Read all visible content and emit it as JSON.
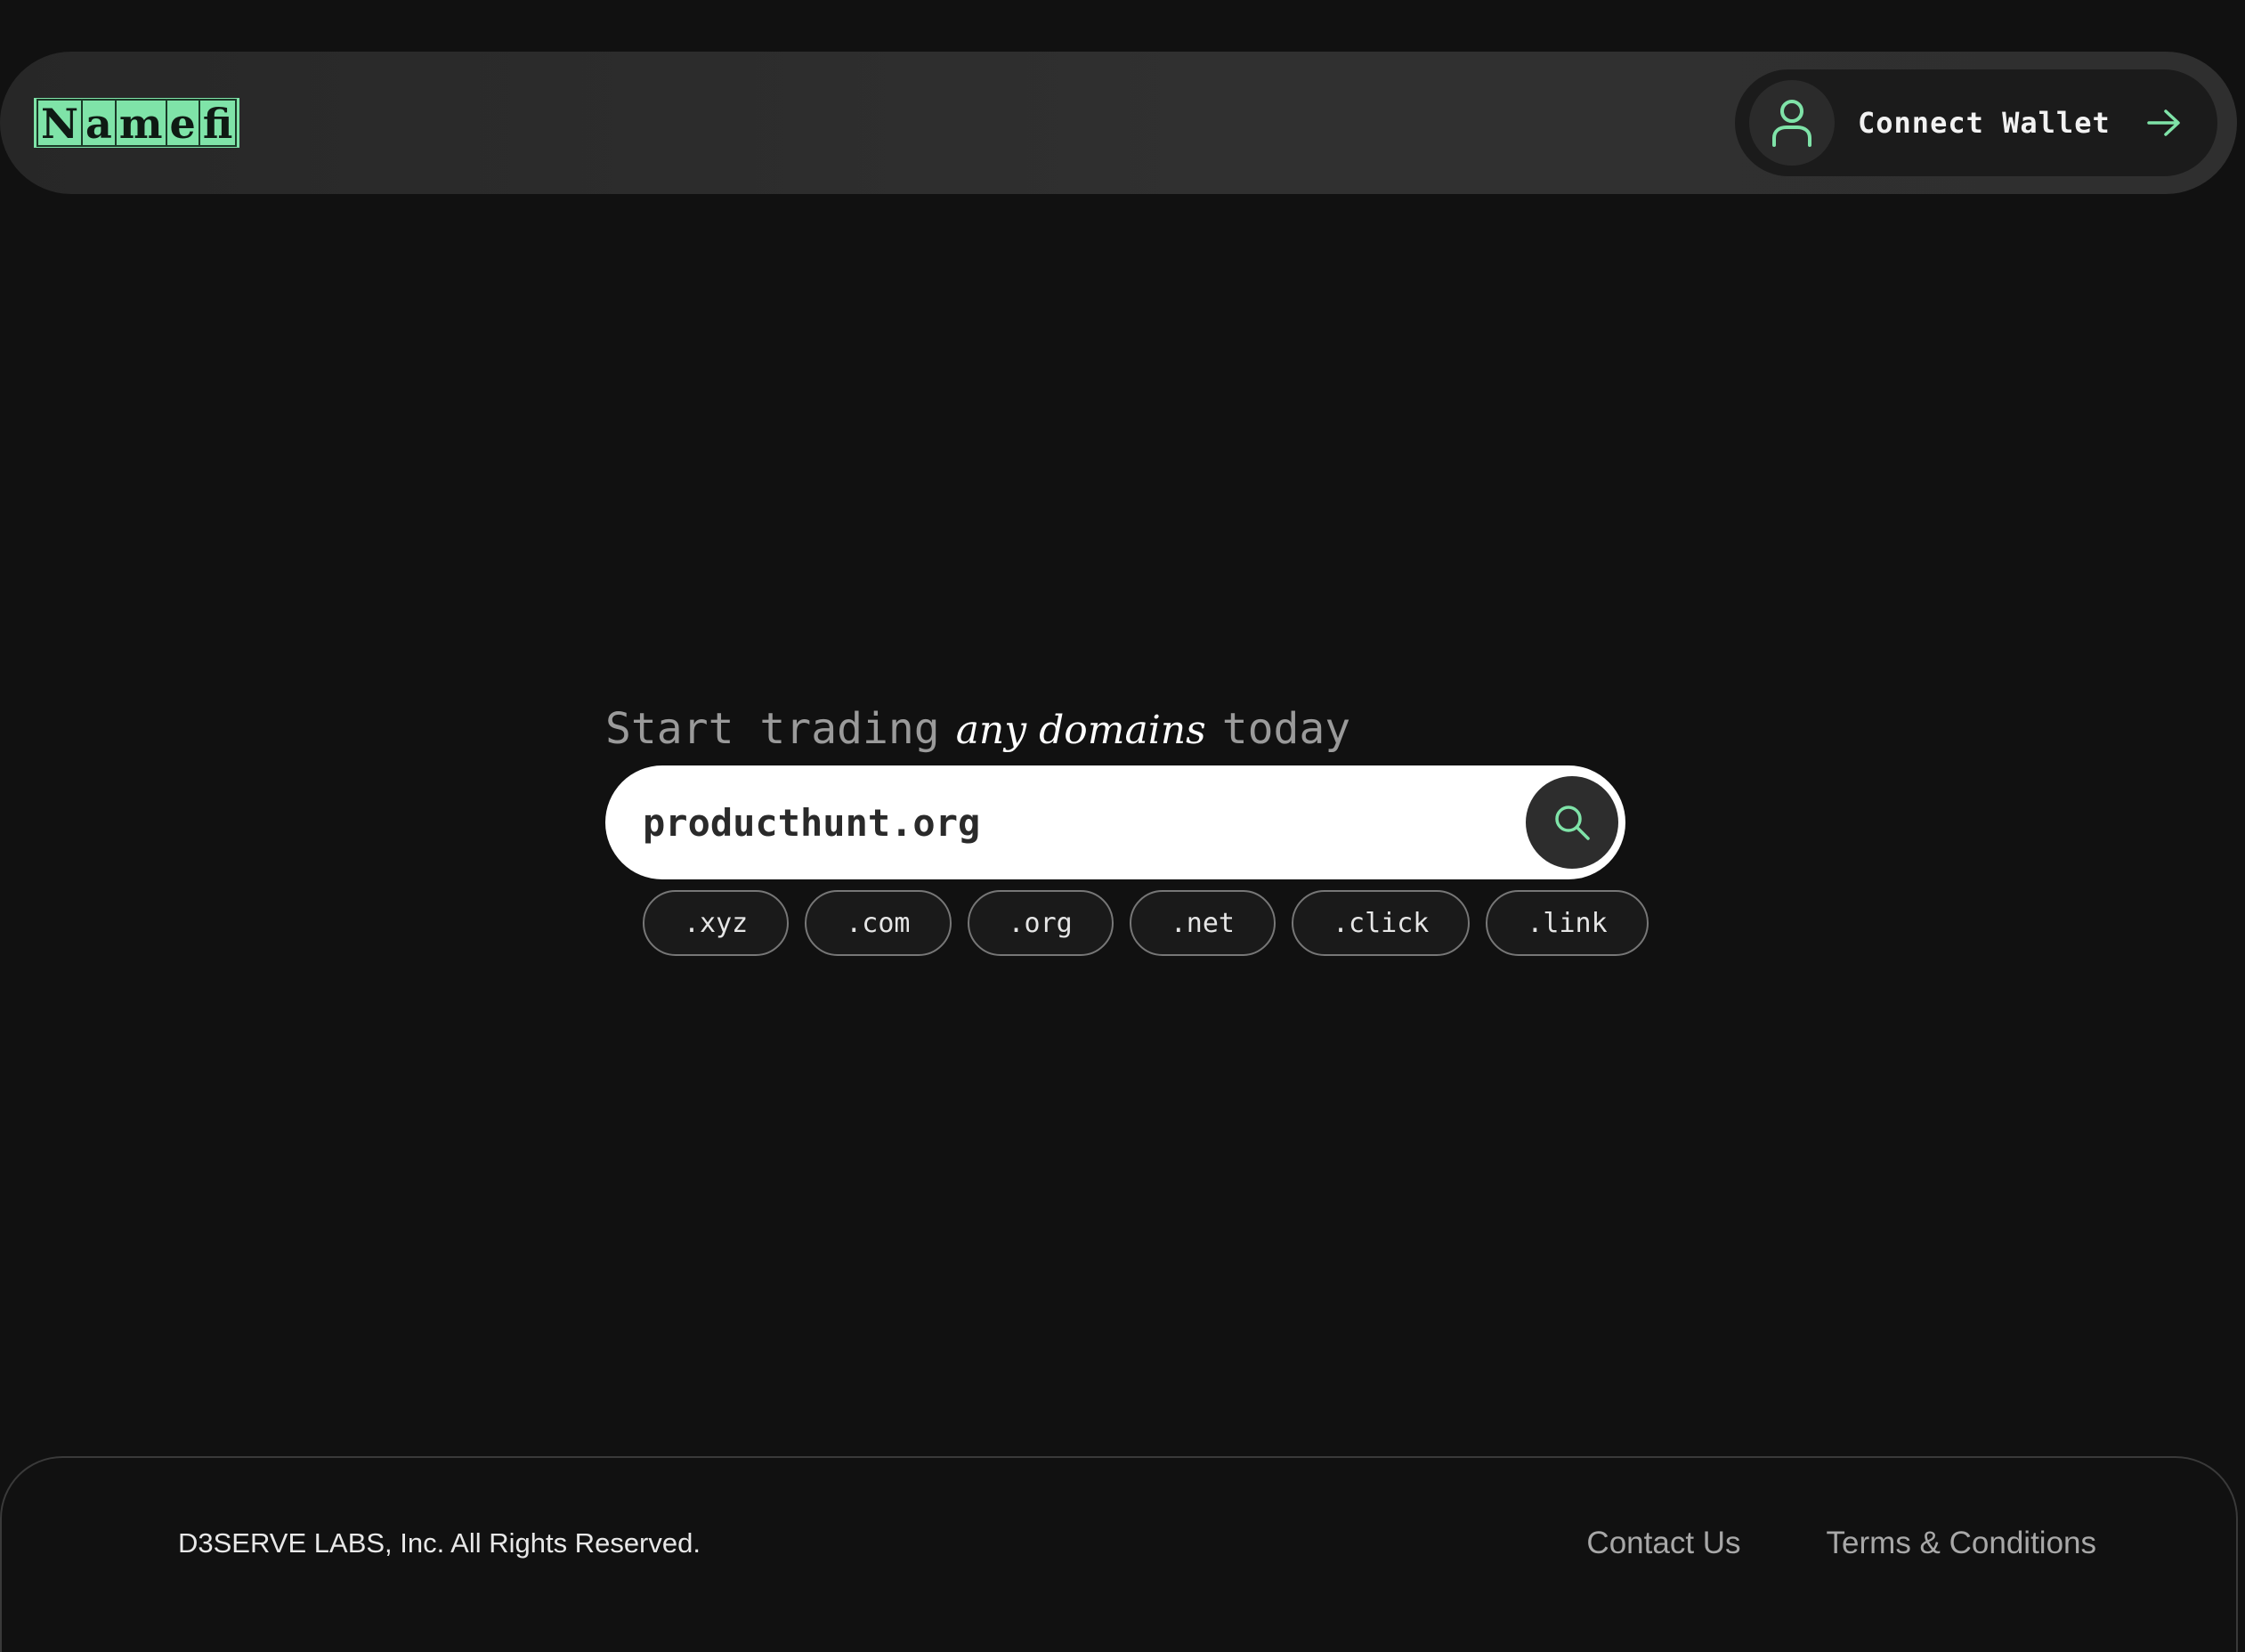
{
  "header": {
    "logo_letters": [
      "N",
      "a",
      "m",
      "e",
      "fi"
    ],
    "connect_wallet_label": "Connect Wallet"
  },
  "hero": {
    "tagline_start": "Start trading",
    "tagline_emphasis": "any domains",
    "tagline_end": "today",
    "search": {
      "value": "producthunt.org",
      "placeholder": ""
    },
    "tlds": [
      ".xyz",
      ".com",
      ".org",
      ".net",
      ".click",
      ".link"
    ]
  },
  "footer": {
    "copyright": "D3SERVE LABS, Inc. All Rights Reserved.",
    "contact_label": "Contact Us",
    "terms_label": "Terms & Conditions"
  },
  "colors": {
    "accent": "#7fe3a8",
    "background": "#111111",
    "header_bg": "#2d2d2d"
  },
  "icons": {
    "wallet": "user-icon",
    "arrow": "arrow-right-icon",
    "search": "search-icon"
  }
}
